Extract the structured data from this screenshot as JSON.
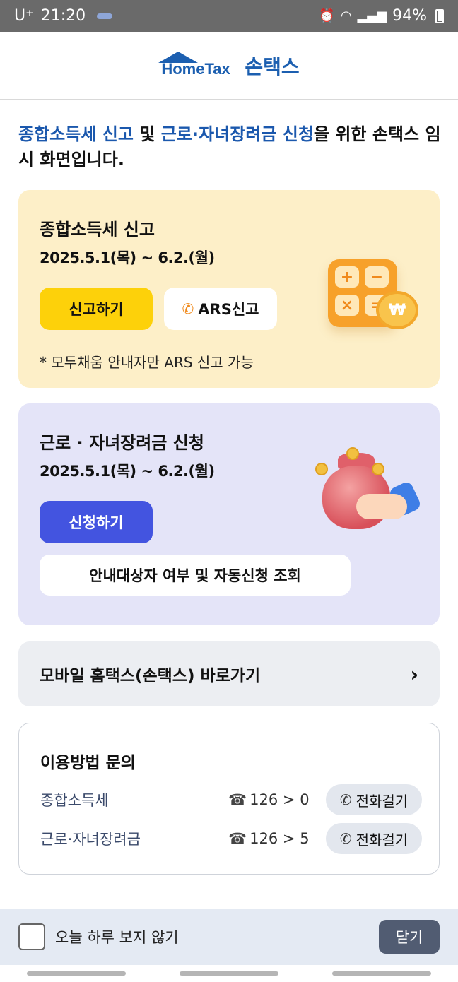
{
  "status_bar": {
    "carrier": "U⁺",
    "time": "21:20",
    "battery": "94%"
  },
  "header": {
    "logo_text": "HomeTax",
    "brand": "손택스"
  },
  "intro": {
    "part1": "종합소득세 신고",
    "part2": " 및 ",
    "part3": "근로·자녀장려금 신청",
    "part4": "을 위한 손택스 임시 화면입니다."
  },
  "income_tax_card": {
    "title": "종합소득세 신고",
    "period": "2025.5.1(목) ~ 6.2.(월)",
    "file_button": "신고하기",
    "ars_button": "ARS신고",
    "note": "* 모두채움 안내자만 ARS 신고 가능",
    "calc_keys": [
      "+",
      "−",
      "×",
      "="
    ],
    "coin_symbol": "₩"
  },
  "incentive_card": {
    "title": "근로 · 자녀장려금 신청",
    "period": "2025.5.1(목) ~ 6.2.(월)",
    "apply_button": "신청하기",
    "lookup_button": "안내대상자 여부 및 자동신청 조회"
  },
  "shortcut": {
    "label": "모바일 홈택스(손택스) 바로가기",
    "arrow": "›"
  },
  "inquiry": {
    "title": "이용방법 문의",
    "rows": [
      {
        "label": "종합소득세",
        "number": "126 > 0",
        "call": "전화걸기"
      },
      {
        "label": "근로·자녀장려금",
        "number": "126 > 5",
        "call": "전화걸기"
      }
    ]
  },
  "bottom": {
    "checkbox_label": "오늘 하루 보지 않기",
    "close": "닫기"
  },
  "icons": {
    "phone": "phone-icon",
    "telephone": "telephone-icon",
    "chevron": "chevron-right-icon"
  },
  "colors": {
    "brand_blue": "#1c5fb0",
    "yellow_card": "#fdefc8",
    "purple_card": "#e4e4f8",
    "yellow_button": "#fdd10a",
    "indigo_button": "#4354e0",
    "close_button": "#515c72"
  }
}
